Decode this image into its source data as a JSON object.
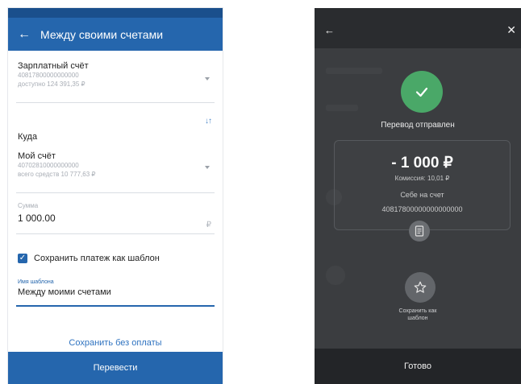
{
  "left": {
    "header": {
      "back_icon": "arrow-left-icon",
      "title": "Между своими счетами"
    },
    "from_account": {
      "name": "Зарплатный счёт",
      "number": "40817800000000000",
      "balance": "доступно 124 391,35 ₽"
    },
    "to_label": "Куда",
    "to_account": {
      "name": "Мой счёт",
      "number": "40702810000000000",
      "balance": "всего средств 10 777,63 ₽"
    },
    "amount": {
      "label": "Сумма",
      "value": "1 000.00",
      "currency": "₽"
    },
    "save_template": {
      "checked": true,
      "label": "Сохранить платеж как шаблон"
    },
    "template_name": {
      "label": "Имя шаблона",
      "value": "Между моими счетами"
    },
    "save_without_payment": "Сохранить без оплаты",
    "pay_button": "Перевести",
    "accent": "#2566ad"
  },
  "right": {
    "status_title": "Перевод отправлен",
    "amount": "- 1 000 ₽",
    "commission": "Комиссия: 10,01 ₽",
    "destination": "Себе на счет",
    "account_number": "40817800000000000000",
    "save_template_caption_line1": "Сохранить как",
    "save_template_caption_line2": "шаблон",
    "done_button": "Готово",
    "success_color": "#4aa868"
  }
}
